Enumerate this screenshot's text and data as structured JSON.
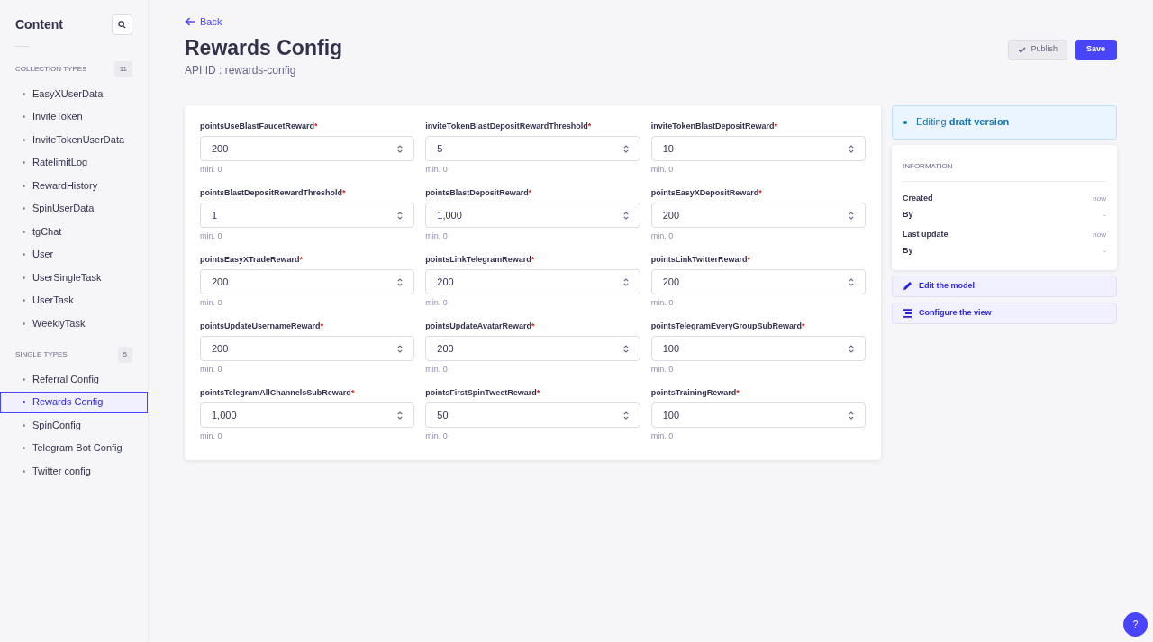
{
  "sidebar": {
    "title": "Content",
    "sections": [
      {
        "heading": "COLLECTION TYPES",
        "count": "11",
        "items": [
          {
            "label": "EasyXUserData",
            "selected": false
          },
          {
            "label": "InviteToken",
            "selected": false
          },
          {
            "label": "InviteTokenUserData",
            "selected": false
          },
          {
            "label": "RatelimitLog",
            "selected": false
          },
          {
            "label": "RewardHistory",
            "selected": false
          },
          {
            "label": "SpinUserData",
            "selected": false
          },
          {
            "label": "tgChat",
            "selected": false
          },
          {
            "label": "User",
            "selected": false
          },
          {
            "label": "UserSingleTask",
            "selected": false
          },
          {
            "label": "UserTask",
            "selected": false
          },
          {
            "label": "WeeklyTask",
            "selected": false
          }
        ]
      },
      {
        "heading": "SINGLE TYPES",
        "count": "5",
        "items": [
          {
            "label": "Referral Config",
            "selected": false
          },
          {
            "label": "Rewards Config",
            "selected": true
          },
          {
            "label": "SpinConfig",
            "selected": false
          },
          {
            "label": "Telegram Bot Config",
            "selected": false
          },
          {
            "label": "Twitter config",
            "selected": false
          }
        ]
      }
    ]
  },
  "header": {
    "back": "Back",
    "title": "Rewards Config",
    "api_id": "API ID : rewards-config",
    "buttons": [
      {
        "kind": "secondary",
        "label": "Publish"
      },
      {
        "kind": "primary",
        "label": "Save"
      }
    ]
  },
  "fields": [
    {
      "label": "pointsUseBlastFaucetReward",
      "required_mark": "*",
      "value": "200",
      "hint": "min. 0"
    },
    {
      "label": "inviteTokenBlastDepositRewardThreshold",
      "required_mark": "*",
      "value": "5",
      "hint": "min. 0"
    },
    {
      "label": "inviteTokenBlastDepositReward",
      "required_mark": "*",
      "value": "10",
      "hint": "min. 0"
    },
    {
      "label": "pointsBlastDepositRewardThreshold",
      "required_mark": "*",
      "value": "1",
      "hint": "min. 0"
    },
    {
      "label": "pointsBlastDepositReward",
      "required_mark": "*",
      "value": "1,000",
      "hint": "min. 0"
    },
    {
      "label": "pointsEasyXDepositReward",
      "required_mark": "*",
      "value": "200",
      "hint": "min. 0"
    },
    {
      "label": "pointsEasyXTradeReward",
      "required_mark": "*",
      "value": "200",
      "hint": "min. 0"
    },
    {
      "label": "pointsLinkTelegramReward",
      "required_mark": "*",
      "value": "200",
      "hint": "min. 0"
    },
    {
      "label": "pointsLinkTwitterReward",
      "required_mark": "*",
      "value": "200",
      "hint": "min. 0"
    },
    {
      "label": "pointsUpdateUsernameReward",
      "required_mark": "*",
      "value": "200",
      "hint": "min. 0"
    },
    {
      "label": "pointsUpdateAvatarReward",
      "required_mark": "*",
      "value": "200",
      "hint": "min. 0"
    },
    {
      "label": "pointsTelegramEveryGroupSubReward",
      "required_mark": "*",
      "value": "100",
      "hint": "min. 0"
    },
    {
      "label": "pointsTelegramAllChannelsSubReward",
      "required_mark": "*",
      "value": "1,000",
      "hint": "min. 0"
    },
    {
      "label": "pointsFirstSpinTweetReward",
      "required_mark": "*",
      "value": "50",
      "hint": "min. 0"
    },
    {
      "label": "pointsTrainingReward",
      "required_mark": "*",
      "value": "100",
      "hint": "min. 0"
    }
  ],
  "status": "Editing **draft version**",
  "information": {
    "heading": "INFORMATION",
    "rows": [
      {
        "label": "Created",
        "value": "now"
      },
      {
        "label": "By",
        "value": "-"
      },
      {
        "label": "Last update",
        "value": "now"
      },
      {
        "label": "By",
        "value": "-"
      }
    ]
  },
  "links": [
    {
      "kind": "edit",
      "label": "Edit the model"
    },
    {
      "kind": "configure",
      "label": "Configure the view"
    }
  ],
  "help": "?"
}
